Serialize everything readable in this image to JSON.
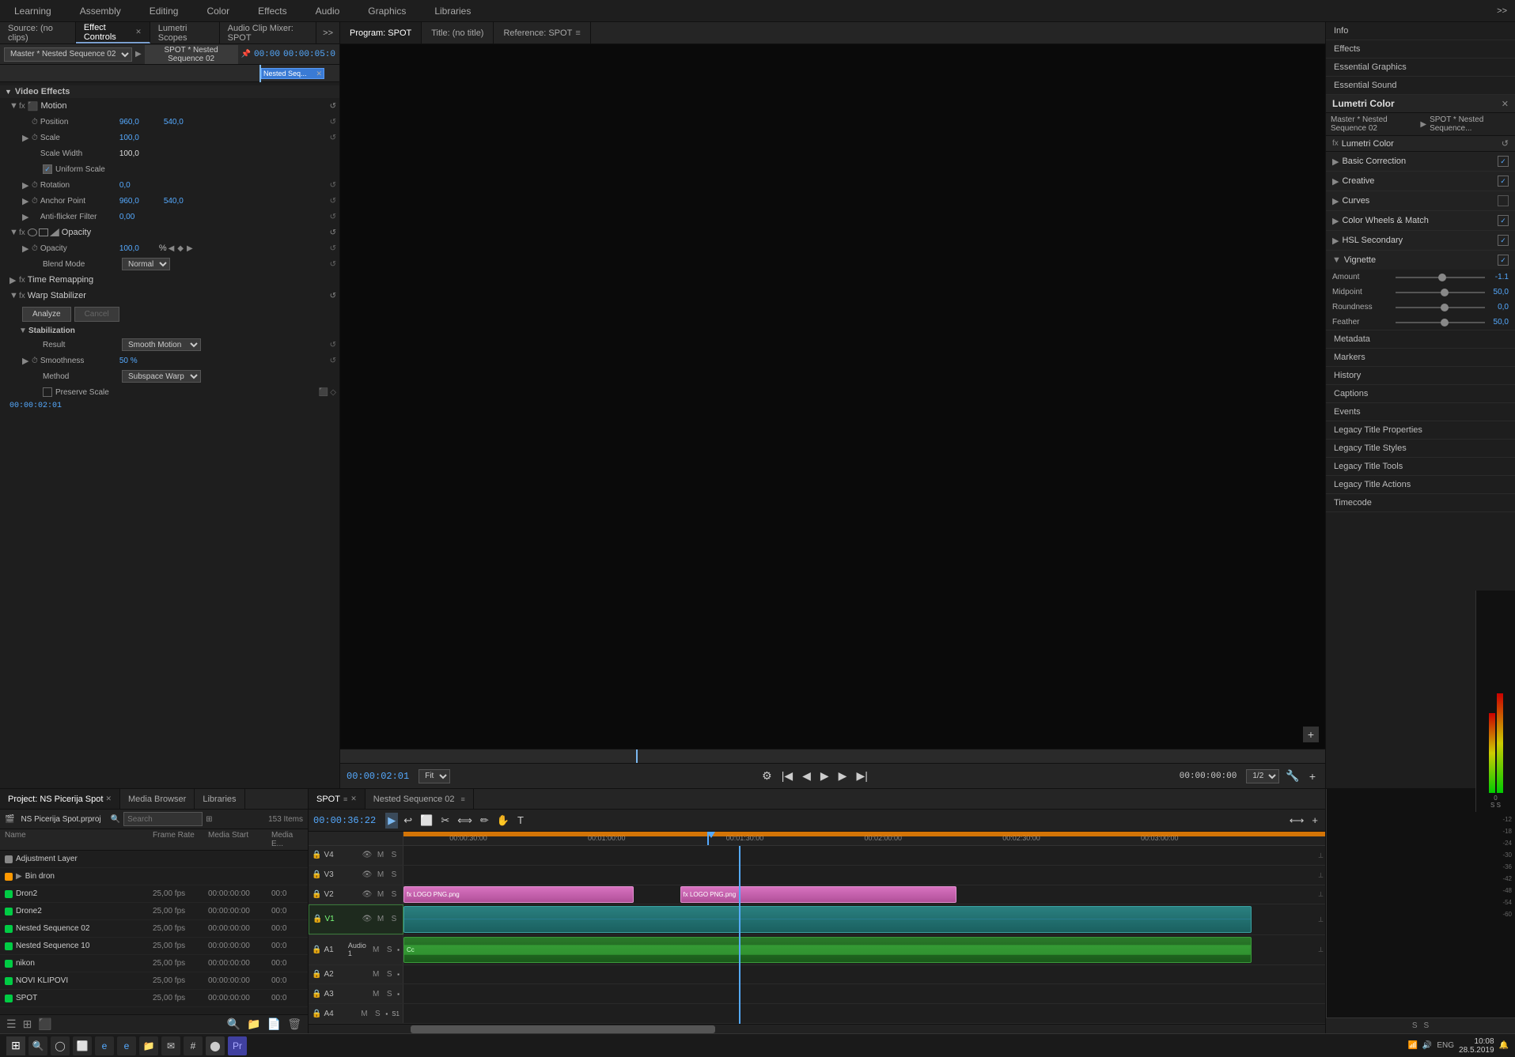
{
  "topnav": {
    "items": [
      {
        "label": "Learning",
        "active": false
      },
      {
        "label": "Assembly",
        "active": false
      },
      {
        "label": "Editing",
        "active": false
      },
      {
        "label": "Color",
        "active": false
      },
      {
        "label": "Effects",
        "active": false
      },
      {
        "label": "Audio",
        "active": false
      },
      {
        "label": "Graphics",
        "active": false
      },
      {
        "label": "Libraries",
        "active": false
      }
    ],
    "more_icon": ">>"
  },
  "left_panel": {
    "tabs": [
      {
        "label": "Source: (no clips)",
        "active": false
      },
      {
        "label": "Effect Controls",
        "active": true
      },
      {
        "label": "Lumetri Scopes",
        "active": false
      },
      {
        "label": "Audio Clip Mixer: SPOT",
        "active": false
      }
    ],
    "more_label": ">>",
    "subheader": {
      "master_label": "Master * Nested Sequence 02",
      "clip_label": "SPOT * Nested Sequence 02",
      "timecode_start": "00:00",
      "timecode_end": "00:00:05:0",
      "clip_name": "Nested Seq..."
    },
    "sections": {
      "video_effects_label": "Video Effects",
      "motion_label": "Motion",
      "position_label": "Position",
      "position_x": "960,0",
      "position_y": "540,0",
      "scale_label": "Scale",
      "scale_value": "100,0",
      "scale_width_label": "Scale Width",
      "scale_width_value": "100,0",
      "uniform_scale_label": "Uniform Scale",
      "rotation_label": "Rotation",
      "rotation_value": "0,0",
      "anchor_point_label": "Anchor Point",
      "anchor_x": "960,0",
      "anchor_y": "540,0",
      "anti_flicker_label": "Anti-flicker Filter",
      "anti_flicker_value": "0,00",
      "opacity_label": "Opacity",
      "opacity_value": "100,0",
      "opacity_unit": "%",
      "blend_mode_label": "Blend Mode",
      "blend_mode_value": "Normal",
      "time_remapping_label": "Time Remapping",
      "warp_stabilizer_label": "Warp Stabilizer",
      "analyze_btn": "Analyze",
      "cancel_btn": "Cancel",
      "stabilization_label": "Stabilization",
      "result_label": "Result",
      "result_value": "Smooth Motion",
      "smoothness_label": "Smoothness",
      "smoothness_value": "50 %",
      "method_label": "Method",
      "method_value": "Subspace Warp",
      "preserve_scale_label": "Preserve Scale"
    }
  },
  "center_panel": {
    "monitor_tabs": [
      {
        "label": "Program: SPOT",
        "active": true
      },
      {
        "label": "Title: (no title)",
        "active": false
      },
      {
        "label": "Reference: SPOT",
        "active": false
      }
    ],
    "timecode": "00:00:02:01",
    "fit_label": "Fit",
    "ratio_label": "1/2",
    "end_timecode": "00:00:00:00"
  },
  "right_panel": {
    "info_label": "Info",
    "items": [
      {
        "label": "Effects"
      },
      {
        "label": "Essential Graphics"
      },
      {
        "label": "Essential Sound"
      }
    ],
    "lumetri_label": "Lumetri Color",
    "lumetri_master": "Master * Nested Sequence 02",
    "lumetri_clip": "SPOT * Nested Sequence...",
    "sections": [
      {
        "label": "Basic Correction",
        "checked": true
      },
      {
        "label": "Creative",
        "checked": true
      },
      {
        "label": "Curves",
        "checked": false
      },
      {
        "label": "Color Wheels & Match",
        "checked": true
      },
      {
        "label": "HSL Secondary",
        "checked": true
      },
      {
        "label": "Vignette",
        "checked": true
      }
    ],
    "vignette": {
      "amount_label": "Amount",
      "amount_value": "-1.1",
      "midpoint_label": "Midpoint",
      "midpoint_value": "50,0",
      "roundness_label": "Roundness",
      "roundness_value": "0,0",
      "feather_label": "Feather",
      "feather_value": "50,0"
    },
    "bottom_items": [
      {
        "label": "Metadata"
      },
      {
        "label": "Markers"
      },
      {
        "label": "History"
      },
      {
        "label": "Captions"
      },
      {
        "label": "Events"
      },
      {
        "label": "Legacy Title Properties"
      },
      {
        "label": "Legacy Title Styles"
      },
      {
        "label": "Legacy Title Tools"
      },
      {
        "label": "Legacy Title Actions"
      },
      {
        "label": "Timecode"
      }
    ]
  },
  "project_panel": {
    "tabs": [
      {
        "label": "Project: NS Picerija Spot",
        "active": true
      },
      {
        "label": "Media Browser",
        "active": false
      },
      {
        "label": "Libraries",
        "active": false
      }
    ],
    "project_file": "NS Picerija Spot.prproj",
    "search_placeholder": "Search",
    "item_count": "153 Items",
    "columns": {
      "name": "Name",
      "frame_rate": "Frame Rate",
      "media_start": "Media Start",
      "media_end": "Media E..."
    },
    "items": [
      {
        "color": "#888",
        "is_folder": false,
        "name": "Adjustment Layer",
        "fps": "",
        "start": "",
        "end": "",
        "icon": "⬛"
      },
      {
        "color": "#ff9900",
        "is_folder": true,
        "name": "Bin dron",
        "fps": "",
        "start": "",
        "end": "",
        "icon": "📁"
      },
      {
        "color": "#00cc44",
        "is_folder": false,
        "name": "Dron2",
        "fps": "25,00 fps",
        "start": "00:00:00:00",
        "end": "00:0",
        "icon": "🎬"
      },
      {
        "color": "#00cc44",
        "is_folder": false,
        "name": "Drone2",
        "fps": "25,00 fps",
        "start": "00:00:00:00",
        "end": "00:0",
        "icon": "🎬"
      },
      {
        "color": "#00cc44",
        "is_folder": false,
        "name": "Nested Sequence 02",
        "fps": "25,00 fps",
        "start": "00:00:00:00",
        "end": "00:0",
        "icon": "🎬"
      },
      {
        "color": "#00cc44",
        "is_folder": false,
        "name": "Nested Sequence 10",
        "fps": "25,00 fps",
        "start": "00:00:00:00",
        "end": "00:0",
        "icon": "🎬"
      },
      {
        "color": "#00cc44",
        "is_folder": false,
        "name": "nikon",
        "fps": "25,00 fps",
        "start": "00:00:00:00",
        "end": "00:0",
        "icon": "🎬"
      },
      {
        "color": "#00cc44",
        "is_folder": false,
        "name": "NOVI KLIPOVI",
        "fps": "25,00 fps",
        "start": "00:00:00:00",
        "end": "00:0",
        "icon": "🎬"
      },
      {
        "color": "#00cc44",
        "is_folder": false,
        "name": "SPOT",
        "fps": "25,00 fps",
        "start": "00:00:00:00",
        "end": "00:0",
        "icon": "🎬"
      }
    ]
  },
  "timeline_panel": {
    "tabs": [
      {
        "label": "SPOT",
        "active": true
      },
      {
        "label": "Nested Sequence 02",
        "active": false
      }
    ],
    "timecode": "00:00:36:22",
    "tools": [
      "▶",
      "↩",
      "✂",
      "🔗",
      "⟲"
    ],
    "tracks": [
      {
        "label": "V4",
        "type": "video"
      },
      {
        "label": "V3",
        "type": "video"
      },
      {
        "label": "V2",
        "type": "video",
        "has_clip": true,
        "clip_color": "pink",
        "clip_label": "LOGO PNG.png"
      },
      {
        "label": "V1",
        "type": "video",
        "active": true,
        "has_clip": true
      },
      {
        "label": "Audio 1",
        "type": "audio",
        "has_clip": true
      },
      {
        "label": "A2",
        "type": "audio"
      },
      {
        "label": "A3",
        "type": "audio"
      },
      {
        "label": "A4",
        "type": "audio"
      }
    ],
    "ruler_times": [
      "00:00:30:00",
      "00:01:00:00",
      "00:01:30:00",
      "00:02:00:00",
      "00:02:30:00",
      "00:03:00:00"
    ]
  }
}
